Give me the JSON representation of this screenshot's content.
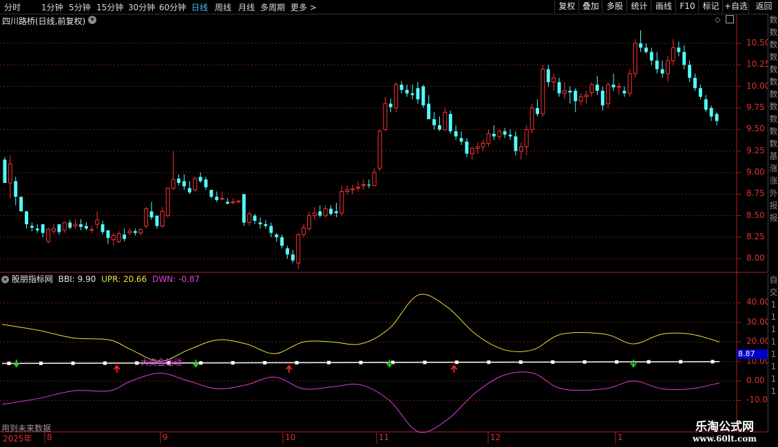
{
  "toolbar": {
    "periods": [
      "分时",
      "1分钟",
      "5分钟",
      "15分钟",
      "30分钟",
      "60分钟",
      "日线",
      "周线",
      "月线",
      "多周期",
      "更多 >"
    ],
    "active_period": "日线",
    "right_buttons": [
      "复权",
      "叠加",
      "多股",
      "统计",
      "画线",
      "F10",
      "标记",
      "+自选",
      "返回"
    ]
  },
  "title": "四川路桥(日线,前复权)",
  "indicator": {
    "name": "股朋指标网",
    "bbi_label": "BBI: 9.90",
    "upr_label": "UPR: 20.66",
    "dwn_label": "DWN: -0.87",
    "annotation": "大资金活动",
    "current_value": "8.87"
  },
  "price_axis": [
    "10.50",
    "10.25",
    "10.00",
    "9.75",
    "9.50",
    "9.25",
    "9.00",
    "8.75",
    "8.50",
    "8.25",
    "8.00"
  ],
  "indicator_axis": [
    "40.00",
    "30.00",
    "20.00",
    "10.00",
    "0.00",
    "-10.00"
  ],
  "date_labels": [
    "2025年",
    "8",
    "9",
    "10",
    "11",
    "12",
    "1"
  ],
  "footer_note": "用到未来数据",
  "watermark": {
    "title": "乐淘公式网",
    "url": "www.60lt.com"
  },
  "side_strip_top": [
    "数",
    "数",
    "数",
    "数",
    "数",
    "数",
    "数",
    "数",
    "数",
    "数",
    "数",
    "基",
    "涨",
    "涨",
    "外",
    "报",
    "报"
  ],
  "side_strip_bottom": [
    "自",
    "交",
    "1",
    "1",
    "1",
    "1",
    "1",
    "1",
    "1",
    "1"
  ],
  "colors": {
    "up": "#ff3333",
    "down": "#54ffff",
    "grid": "#7a1c1c",
    "upper": "#e8e83a",
    "lower": "#e040e0",
    "mid": "#ffffff"
  },
  "chart_data": {
    "type": "candlestick",
    "price_ylim": [
      7.85,
      10.7
    ],
    "candles": [
      [
        9.15,
        9.18,
        8.88,
        8.88
      ],
      [
        8.88,
        9.2,
        8.7,
        9.1
      ],
      [
        8.9,
        8.95,
        8.62,
        8.72
      ],
      [
        8.72,
        8.72,
        8.55,
        8.55
      ],
      [
        8.55,
        8.55,
        8.35,
        8.4
      ],
      [
        8.38,
        8.42,
        8.32,
        8.36
      ],
      [
        8.35,
        8.4,
        8.3,
        8.33
      ],
      [
        8.4,
        8.4,
        8.25,
        8.3
      ],
      [
        8.2,
        8.36,
        8.18,
        8.34
      ],
      [
        8.32,
        8.4,
        8.28,
        8.35
      ],
      [
        8.4,
        8.4,
        8.28,
        8.31
      ],
      [
        8.33,
        8.43,
        8.3,
        8.42
      ],
      [
        8.42,
        8.45,
        8.34,
        8.36
      ],
      [
        8.38,
        8.46,
        8.35,
        8.4
      ],
      [
        8.4,
        8.46,
        8.33,
        8.37
      ],
      [
        8.38,
        8.42,
        8.33,
        8.35
      ],
      [
        8.33,
        8.38,
        8.3,
        8.34
      ],
      [
        8.4,
        8.55,
        8.35,
        8.45
      ],
      [
        8.4,
        8.44,
        8.28,
        8.31
      ],
      [
        8.33,
        8.33,
        8.17,
        8.24
      ],
      [
        8.22,
        8.3,
        8.15,
        8.27
      ],
      [
        8.2,
        8.32,
        8.18,
        8.29
      ],
      [
        8.28,
        8.35,
        8.2,
        8.23
      ],
      [
        8.3,
        8.35,
        8.28,
        8.32
      ],
      [
        8.32,
        8.35,
        8.27,
        8.3
      ],
      [
        8.3,
        8.35,
        8.27,
        8.34
      ],
      [
        8.38,
        8.6,
        8.35,
        8.58
      ],
      [
        8.55,
        8.66,
        8.45,
        8.48
      ],
      [
        8.5,
        8.5,
        8.35,
        8.38
      ],
      [
        8.38,
        8.6,
        8.36,
        8.55
      ],
      [
        8.5,
        8.83,
        8.48,
        8.82
      ],
      [
        8.82,
        9.25,
        8.8,
        8.92
      ],
      [
        8.93,
        8.98,
        8.85,
        8.88
      ],
      [
        8.9,
        8.98,
        8.8,
        8.84
      ],
      [
        8.82,
        8.9,
        8.75,
        8.77
      ],
      [
        8.8,
        8.95,
        8.78,
        8.93
      ],
      [
        8.95,
        9.0,
        8.88,
        8.9
      ],
      [
        8.92,
        8.95,
        8.8,
        8.83
      ],
      [
        8.8,
        8.8,
        8.7,
        8.72
      ],
      [
        8.72,
        8.78,
        8.66,
        8.68
      ],
      [
        8.7,
        8.78,
        8.68,
        8.7
      ],
      [
        8.66,
        8.7,
        8.63,
        8.64
      ],
      [
        8.65,
        8.7,
        8.63,
        8.66
      ],
      [
        8.66,
        8.68,
        8.65,
        8.67
      ],
      [
        8.75,
        8.75,
        8.38,
        8.42
      ],
      [
        8.42,
        8.55,
        8.38,
        8.52
      ],
      [
        8.5,
        8.52,
        8.4,
        8.44
      ],
      [
        8.42,
        8.48,
        8.35,
        8.4
      ],
      [
        8.4,
        8.45,
        8.35,
        8.38
      ],
      [
        8.38,
        8.42,
        8.25,
        8.3
      ],
      [
        8.28,
        8.3,
        8.2,
        8.25
      ],
      [
        8.25,
        8.28,
        8.12,
        8.15
      ],
      [
        8.12,
        8.15,
        8.0,
        8.05
      ],
      [
        8.05,
        8.1,
        7.95,
        7.98
      ],
      [
        7.95,
        8.3,
        7.88,
        8.28
      ],
      [
        8.28,
        8.4,
        8.25,
        8.36
      ],
      [
        8.35,
        8.55,
        8.32,
        8.5
      ],
      [
        8.5,
        8.6,
        8.45,
        8.53
      ],
      [
        8.55,
        8.62,
        8.48,
        8.5
      ],
      [
        8.5,
        8.62,
        8.48,
        8.58
      ],
      [
        8.58,
        8.62,
        8.5,
        8.52
      ],
      [
        8.55,
        8.65,
        8.48,
        8.53
      ],
      [
        8.53,
        8.85,
        8.5,
        8.78
      ],
      [
        8.78,
        8.85,
        8.75,
        8.8
      ],
      [
        8.8,
        8.86,
        8.75,
        8.81
      ],
      [
        8.82,
        8.9,
        8.78,
        8.83
      ],
      [
        8.85,
        8.92,
        8.8,
        8.86
      ],
      [
        8.86,
        8.92,
        8.82,
        8.85
      ],
      [
        8.85,
        9.05,
        8.84,
        9.0
      ],
      [
        9.05,
        9.5,
        9.02,
        9.48
      ],
      [
        9.5,
        9.88,
        9.48,
        9.8
      ],
      [
        9.8,
        9.86,
        9.7,
        9.76
      ],
      [
        9.75,
        10.05,
        9.7,
        10.02
      ],
      [
        10.02,
        10.06,
        9.92,
        9.96
      ],
      [
        9.96,
        10.02,
        9.88,
        9.92
      ],
      [
        9.92,
        10.02,
        9.85,
        9.9
      ],
      [
        9.98,
        10.05,
        9.8,
        9.85
      ],
      [
        10.0,
        10.02,
        9.75,
        9.78
      ],
      [
        9.8,
        9.9,
        9.7,
        9.62
      ],
      [
        9.62,
        9.7,
        9.5,
        9.55
      ],
      [
        9.55,
        9.65,
        9.48,
        9.5
      ],
      [
        9.5,
        9.75,
        9.48,
        9.7
      ],
      [
        9.68,
        9.72,
        9.45,
        9.48
      ],
      [
        9.48,
        9.55,
        9.38,
        9.42
      ],
      [
        9.4,
        9.48,
        9.32,
        9.36
      ],
      [
        9.36,
        9.4,
        9.18,
        9.22
      ],
      [
        9.22,
        9.3,
        9.15,
        9.28
      ],
      [
        9.28,
        9.35,
        9.22,
        9.3
      ],
      [
        9.3,
        9.38,
        9.25,
        9.34
      ],
      [
        9.34,
        9.5,
        9.3,
        9.45
      ],
      [
        9.45,
        9.55,
        9.38,
        9.42
      ],
      [
        9.42,
        9.5,
        9.38,
        9.48
      ],
      [
        9.48,
        9.52,
        9.4,
        9.44
      ],
      [
        9.44,
        9.5,
        9.38,
        9.42
      ],
      [
        9.42,
        9.48,
        9.2,
        9.25
      ],
      [
        9.25,
        9.35,
        9.15,
        9.3
      ],
      [
        9.3,
        9.55,
        9.2,
        9.5
      ],
      [
        9.5,
        9.8,
        9.45,
        9.75
      ],
      [
        9.75,
        9.85,
        9.65,
        9.68
      ],
      [
        9.68,
        10.25,
        9.65,
        10.2
      ],
      [
        10.2,
        10.25,
        10.0,
        10.05
      ],
      [
        10.05,
        10.15,
        9.95,
        10.1
      ],
      [
        10.05,
        10.1,
        9.88,
        9.92
      ],
      [
        9.92,
        10.05,
        9.85,
        9.95
      ],
      [
        9.95,
        10.0,
        9.8,
        9.93
      ],
      [
        9.95,
        9.98,
        9.7,
        9.83
      ],
      [
        9.83,
        9.92,
        9.78,
        9.88
      ],
      [
        9.88,
        9.95,
        9.8,
        9.9
      ],
      [
        9.93,
        10.05,
        9.88,
        10.02
      ],
      [
        10.02,
        10.12,
        9.9,
        9.95
      ],
      [
        9.95,
        10.0,
        9.72,
        9.78
      ],
      [
        9.8,
        10.05,
        9.75,
        10.02
      ],
      [
        10.02,
        10.15,
        9.95,
        9.99
      ],
      [
        9.99,
        10.05,
        9.9,
        10.0
      ],
      [
        9.95,
        10.0,
        9.88,
        9.92
      ],
      [
        9.92,
        10.2,
        9.88,
        10.15
      ],
      [
        10.15,
        10.55,
        10.1,
        10.5
      ],
      [
        10.5,
        10.65,
        10.4,
        10.45
      ],
      [
        10.45,
        10.5,
        10.38,
        10.4
      ],
      [
        10.4,
        10.45,
        10.25,
        10.3
      ],
      [
        10.3,
        10.4,
        10.15,
        10.2
      ],
      [
        10.2,
        10.3,
        10.1,
        10.15
      ],
      [
        10.15,
        10.35,
        10.05,
        10.3
      ],
      [
        10.3,
        10.55,
        10.25,
        10.45
      ],
      [
        10.45,
        10.52,
        10.35,
        10.4
      ],
      [
        10.4,
        10.48,
        10.2,
        10.25
      ],
      [
        10.25,
        10.3,
        10.05,
        10.1
      ],
      [
        10.1,
        10.15,
        9.95,
        9.98
      ],
      [
        9.98,
        10.02,
        9.85,
        9.88
      ],
      [
        9.85,
        9.9,
        9.7,
        9.73
      ],
      [
        9.75,
        9.78,
        9.6,
        9.65
      ],
      [
        9.68,
        9.7,
        9.55,
        9.6
      ]
    ],
    "indicator": {
      "ylim": [
        -25,
        50
      ],
      "upper": [
        {
          "x": 0,
          "y": 29
        },
        {
          "x": 0.05,
          "y": 26
        },
        {
          "x": 0.1,
          "y": 22
        },
        {
          "x": 0.15,
          "y": 21
        },
        {
          "x": 0.18,
          "y": 16
        },
        {
          "x": 0.22,
          "y": 10
        },
        {
          "x": 0.26,
          "y": 16
        },
        {
          "x": 0.3,
          "y": 21
        },
        {
          "x": 0.34,
          "y": 19
        },
        {
          "x": 0.38,
          "y": 14
        },
        {
          "x": 0.42,
          "y": 20
        },
        {
          "x": 0.46,
          "y": 20
        },
        {
          "x": 0.5,
          "y": 19
        },
        {
          "x": 0.54,
          "y": 27
        },
        {
          "x": 0.58,
          "y": 44
        },
        {
          "x": 0.62,
          "y": 38
        },
        {
          "x": 0.66,
          "y": 24
        },
        {
          "x": 0.7,
          "y": 16
        },
        {
          "x": 0.74,
          "y": 16
        },
        {
          "x": 0.78,
          "y": 24
        },
        {
          "x": 0.84,
          "y": 24
        },
        {
          "x": 0.88,
          "y": 19
        },
        {
          "x": 0.92,
          "y": 24
        },
        {
          "x": 0.96,
          "y": 24
        },
        {
          "x": 1,
          "y": 20
        }
      ],
      "lower": [
        {
          "x": 0,
          "y": -12
        },
        {
          "x": 0.05,
          "y": -9
        },
        {
          "x": 0.1,
          "y": -5
        },
        {
          "x": 0.15,
          "y": -5
        },
        {
          "x": 0.18,
          "y": 0
        },
        {
          "x": 0.22,
          "y": 4
        },
        {
          "x": 0.26,
          "y": 0
        },
        {
          "x": 0.3,
          "y": -4
        },
        {
          "x": 0.34,
          "y": -2
        },
        {
          "x": 0.38,
          "y": 2
        },
        {
          "x": 0.42,
          "y": -4
        },
        {
          "x": 0.46,
          "y": -3
        },
        {
          "x": 0.5,
          "y": -2
        },
        {
          "x": 0.54,
          "y": -10
        },
        {
          "x": 0.58,
          "y": -26
        },
        {
          "x": 0.62,
          "y": -20
        },
        {
          "x": 0.66,
          "y": -6
        },
        {
          "x": 0.7,
          "y": 3
        },
        {
          "x": 0.74,
          "y": 4
        },
        {
          "x": 0.78,
          "y": -4
        },
        {
          "x": 0.84,
          "y": -4
        },
        {
          "x": 0.88,
          "y": 0
        },
        {
          "x": 0.92,
          "y": -4
        },
        {
          "x": 0.96,
          "y": -4
        },
        {
          "x": 1,
          "y": -1
        }
      ],
      "mid_value_start": 9.0,
      "mid_value_end": 9.9,
      "buy_signals_x": [
        0.16,
        0.4,
        0.63
      ],
      "sell_signals_x": [
        0.02,
        0.27,
        0.54,
        0.88
      ]
    }
  }
}
